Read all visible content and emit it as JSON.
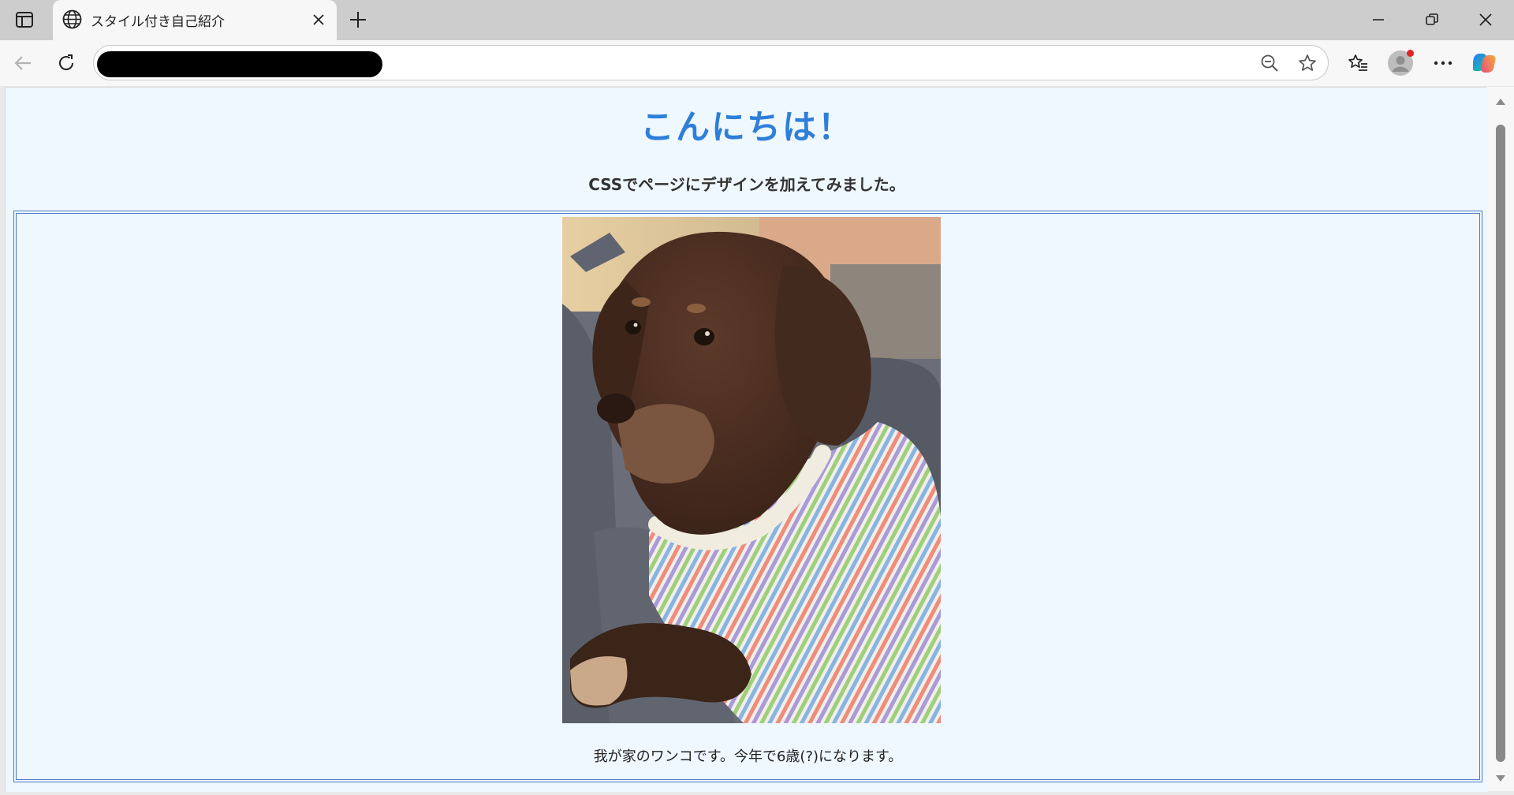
{
  "browser": {
    "tab_title": "スタイル付き自己紹介",
    "icons": {
      "sidebar": "sidebar-toggle-icon",
      "tab": "globe-icon",
      "close": "close-icon",
      "new_tab": "plus-icon",
      "minimize": "minimize-icon",
      "restore": "restore-icon",
      "window_close": "close-icon",
      "back": "back-arrow-icon",
      "refresh": "refresh-icon",
      "zoom": "zoom-out-icon",
      "favorite": "star-icon",
      "favorites": "favorites-list-icon",
      "profile": "profile-avatar-icon",
      "more": "more-dots-icon",
      "copilot": "copilot-icon"
    }
  },
  "page": {
    "heading": "こんにちは！",
    "subheading": "CSSでページにデザインを加えてみました。",
    "caption": "我が家のワンコです。今年で6歳(?)になります。",
    "colors": {
      "background": "#eff7ff",
      "heading": "#2e7fd9",
      "card_border": "#4f79c4"
    }
  }
}
